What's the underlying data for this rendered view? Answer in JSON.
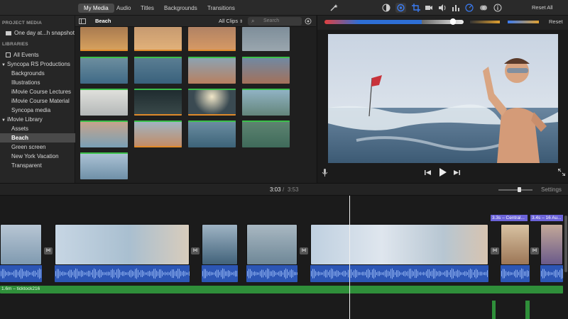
{
  "tabs": [
    {
      "label": "My Media"
    },
    {
      "label": "Audio"
    },
    {
      "label": "Titles"
    },
    {
      "label": "Backgrounds"
    },
    {
      "label": "Transitions"
    }
  ],
  "tools": {
    "reset_all": "Reset All"
  },
  "adjust": {
    "reset": "Reset"
  },
  "sidebar": {
    "project_header": "PROJECT MEDIA",
    "project_item": "One day at...h snapshot",
    "libraries_header": "LIBRARIES",
    "items": [
      {
        "label": "All Events"
      },
      {
        "label": "Syncopa RS Productions"
      },
      {
        "label": "Backgrounds"
      },
      {
        "label": "Illustrations"
      },
      {
        "label": "iMovie Course Lectures"
      },
      {
        "label": "iMovie Course Material"
      },
      {
        "label": "Syncopa media"
      },
      {
        "label": "iMovie Library"
      },
      {
        "label": "Assets"
      },
      {
        "label": "Beach"
      },
      {
        "label": "Green screen"
      },
      {
        "label": "New York Vacation"
      },
      {
        "label": "Transparent"
      }
    ],
    "selected": "Beach"
  },
  "browser": {
    "event_title": "Beach",
    "filter": "All Clips",
    "search_placeholder": "Search"
  },
  "timeline": {
    "current_time": "3:03",
    "separator": "/",
    "total_time": "3:53",
    "settings": "Settings",
    "zoom_level": 0.6,
    "clip_label_1": "3.3s – Central...",
    "clip_label_2": "3.4s – 16 Au...",
    "music_label": "1.6m – ticktock216"
  },
  "colors": {
    "accent_blue": "#3a7bf2",
    "audio_blue": "#2c56b5",
    "music_green": "#2f8f3a",
    "clip_title_purple": "#6b63d9",
    "selected_green": "#3bc04a"
  }
}
